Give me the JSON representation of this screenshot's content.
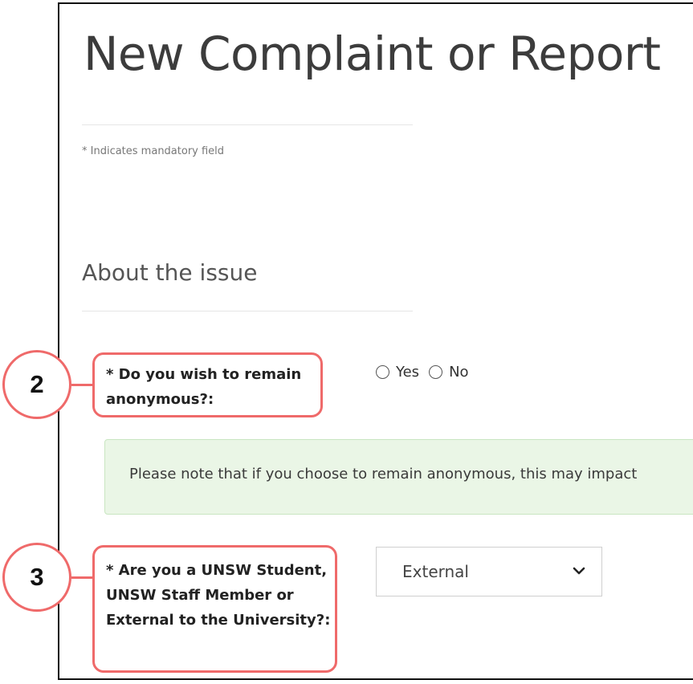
{
  "form": {
    "title": "New Complaint or Report",
    "mandatory_note": "* Indicates mandatory field",
    "section_heading": "About the issue"
  },
  "fields": {
    "anonymous": {
      "label": "* Do you wish to remain anonymous?:",
      "options": [
        "Yes",
        "No"
      ]
    },
    "anonymity_notice": "Please note that if you choose to remain anonymous, this may impact",
    "status": {
      "label": "* Are you a UNSW Student, UNSW Staff Member or External to the University?:",
      "selected": "External"
    }
  },
  "annotations": {
    "badge_2": "2",
    "badge_3": "3"
  },
  "colors": {
    "callout": "#ef6a6a",
    "alert_bg": "#eaf6e6"
  }
}
